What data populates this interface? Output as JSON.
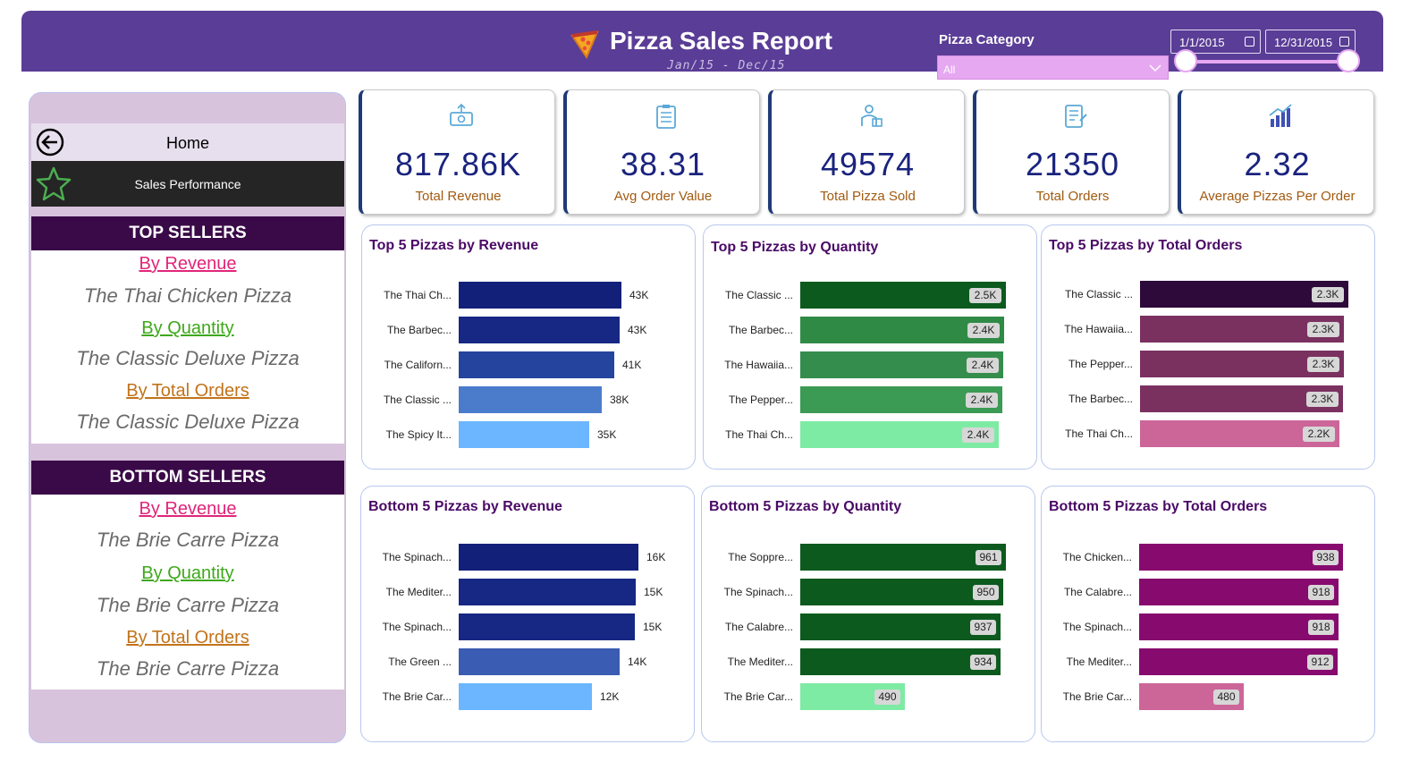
{
  "header": {
    "title": "Pizza Sales Report",
    "subtitle": "Jan/15 - Dec/15",
    "category_label": "Pizza Category",
    "category_value": "All",
    "date_start": "1/1/2015",
    "date_end": "12/31/2015",
    "range_start_fraction": 0,
    "range_end_fraction": 1
  },
  "nav": {
    "home_label": "Home",
    "sales_label": "Sales Performance",
    "top": {
      "heading": "TOP SELLERS",
      "by_revenue": "By Revenue",
      "revenue_pizza": "The Thai Chicken Pizza",
      "by_quantity": "By Quantity",
      "quantity_pizza": "The Classic Deluxe Pizza",
      "by_orders": "By Total Orders",
      "orders_pizza": "The Classic Deluxe Pizza"
    },
    "bottom": {
      "heading": "BOTTOM SELLERS",
      "by_revenue": "By Revenue",
      "revenue_pizza": "The Brie Carre Pizza",
      "by_quantity": "By Quantity",
      "quantity_pizza": "The Brie Carre Pizza",
      "by_orders": "By Total Orders",
      "orders_pizza": "The Brie Carre Pizza"
    }
  },
  "kpis": [
    {
      "value": "817.86K",
      "label": "Total Revenue",
      "icon": "money-icon"
    },
    {
      "value": "38.31",
      "label": "Avg Order Value",
      "icon": "clipboard-icon"
    },
    {
      "value": "49574",
      "label": "Total Pizza Sold",
      "icon": "delivery-icon"
    },
    {
      "value": "21350",
      "label": "Total Orders",
      "icon": "order-list-icon"
    },
    {
      "value": "2.32",
      "label": "Average Pizzas Per Order",
      "icon": "bar-growth-icon"
    }
  ],
  "colors": {
    "header": "#5a3d96",
    "kpi_value": "#1a237e",
    "kpi_label": "#a15a10"
  },
  "chart_data": [
    {
      "type": "bar",
      "title": "Top 5 Pizzas by Revenue",
      "categories": [
        "The Thai Ch...",
        "The Barbec...",
        "The Californ...",
        "The Classic ...",
        "The Spicy It..."
      ],
      "values": [
        43434.25,
        42768,
        41409.5,
        38180.5,
        34831.25
      ],
      "labels": [
        "43K",
        "43K",
        "41K",
        "38K",
        "35K"
      ],
      "colors": [
        "#13207a",
        "#172784",
        "#24449e",
        "#4b7ccc",
        "#6cb6ff"
      ],
      "xlim": [
        0,
        50000
      ],
      "label_style": "outside"
    },
    {
      "type": "bar",
      "title": "Top 5 Pizzas by Quantity",
      "categories": [
        "The Classic ...",
        "The Barbec...",
        "The Hawaiia...",
        "The Pepper...",
        "The Thai Ch..."
      ],
      "values": [
        2453,
        2432,
        2422,
        2418,
        2371
      ],
      "labels": [
        "2.5K",
        "2.4K",
        "2.4K",
        "2.4K",
        "2.4K"
      ],
      "colors": [
        "#0c5a1e",
        "#2f8a45",
        "#348d4c",
        "#3b9a54",
        "#7eeba4"
      ],
      "xlim": [
        0,
        2800
      ],
      "label_style": "inside"
    },
    {
      "type": "bar",
      "title": "Top 5 Pizzas by Total Orders",
      "categories": [
        "The Classic ...",
        "The Hawaiia...",
        "The Pepper...",
        "The Barbec...",
        "The Thai Ch..."
      ],
      "values": [
        2329,
        2280,
        2278,
        2273,
        2225
      ],
      "labels": [
        "2.3K",
        "2.3K",
        "2.3K",
        "2.3K",
        "2.2K"
      ],
      "colors": [
        "#2d0a3a",
        "#7a3160",
        "#7a3160",
        "#7a3160",
        "#cc6699"
      ],
      "xlim": [
        0,
        2600
      ],
      "label_style": "inside"
    },
    {
      "type": "bar",
      "title": "Bottom 5 Pizzas by Revenue",
      "categories": [
        "The Spinach...",
        "The Mediter...",
        "The Spinach...",
        "The Green ...",
        "The Brie Car..."
      ],
      "values": [
        15596,
        15360.5,
        15277.75,
        13955.75,
        11588.5
      ],
      "labels": [
        "16K",
        "15K",
        "15K",
        "14K",
        "12K"
      ],
      "colors": [
        "#13207a",
        "#172784",
        "#172784",
        "#3a5cb2",
        "#6cb6ff"
      ],
      "xlim": [
        0,
        18500
      ],
      "label_style": "outside"
    },
    {
      "type": "bar",
      "title": "Bottom 5 Pizzas by Quantity",
      "categories": [
        "The Soppre...",
        "The Spinach...",
        "The Calabre...",
        "The Mediter...",
        "The Brie Car..."
      ],
      "values": [
        961,
        950,
        937,
        934,
        490
      ],
      "labels": [
        "961",
        "950",
        "937",
        "934",
        "490"
      ],
      "colors": [
        "#0c5a1e",
        "#0c5a1e",
        "#0c5a1e",
        "#0c5a1e",
        "#7eeba4"
      ],
      "xlim": [
        0,
        1090
      ],
      "label_style": "inside"
    },
    {
      "type": "bar",
      "title": "Bottom 5 Pizzas by Total Orders",
      "categories": [
        "The Chicken...",
        "The Calabre...",
        "The Spinach...",
        "The Mediter...",
        "The Brie Car..."
      ],
      "values": [
        938,
        918,
        918,
        912,
        480
      ],
      "labels": [
        "938",
        "918",
        "918",
        "912",
        "480"
      ],
      "colors": [
        "#870a6e",
        "#870a6e",
        "#870a6e",
        "#870a6e",
        "#cc6699"
      ],
      "xlim": [
        0,
        1060
      ],
      "label_style": "inside"
    }
  ]
}
